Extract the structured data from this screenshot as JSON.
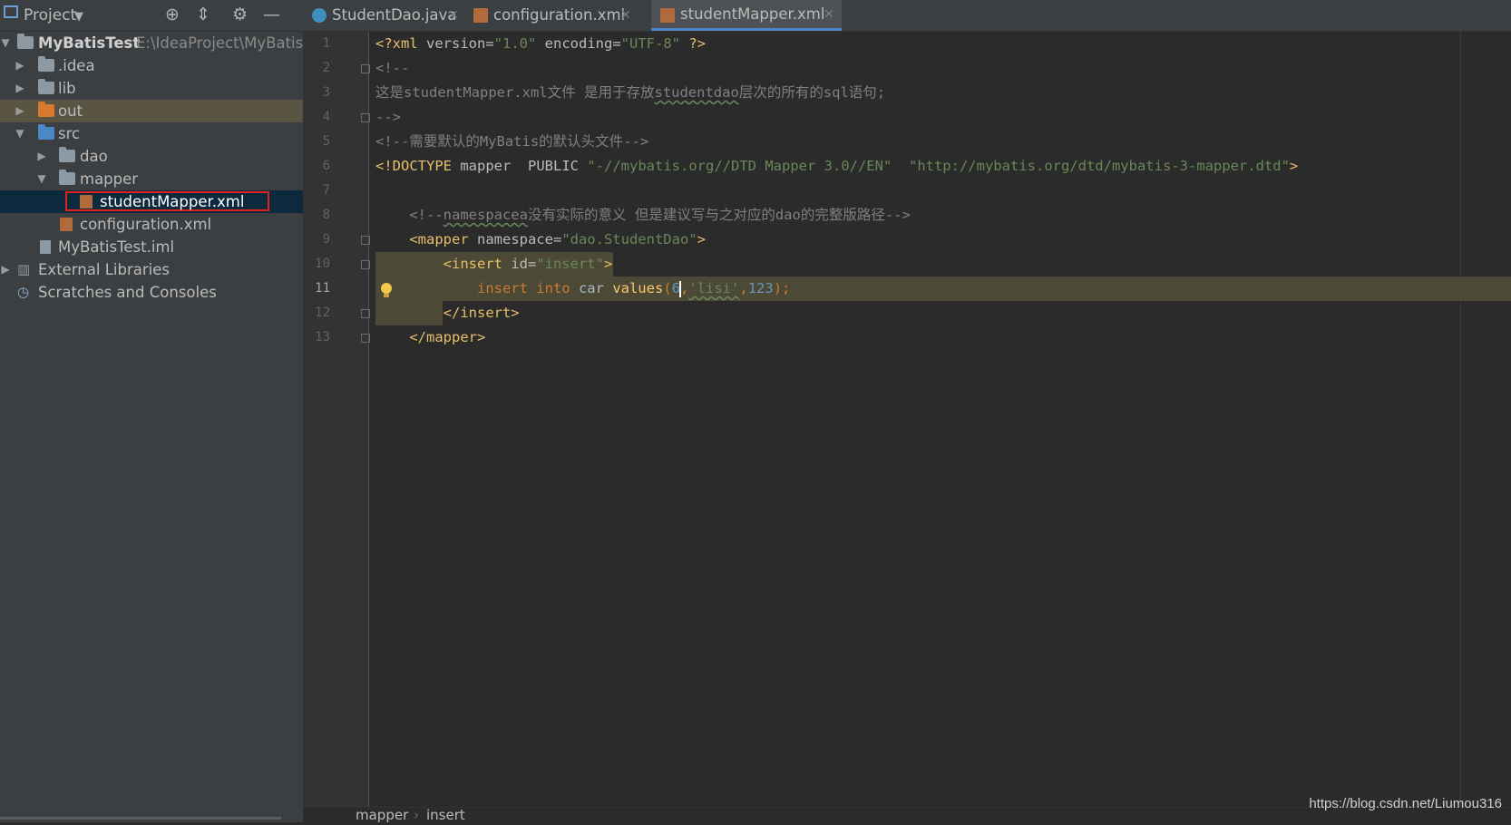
{
  "sidebar": {
    "title": "Project",
    "tree": [
      {
        "label": "MyBatisTest",
        "path": "E:\\IdeaProject\\MyBatisTe"
      },
      {
        "label": ".idea"
      },
      {
        "label": "lib"
      },
      {
        "label": "out"
      },
      {
        "label": "src"
      },
      {
        "label": "dao"
      },
      {
        "label": "mapper"
      },
      {
        "label": "studentMapper.xml"
      },
      {
        "label": "configuration.xml"
      },
      {
        "label": "MyBatisTest.iml"
      },
      {
        "label": "External Libraries"
      },
      {
        "label": "Scratches and Consoles"
      }
    ]
  },
  "tabs": [
    {
      "label": "StudentDao.java",
      "icon": "java-class-icon"
    },
    {
      "label": "configuration.xml",
      "icon": "xml-file-icon"
    },
    {
      "label": "studentMapper.xml",
      "icon": "xml-file-icon",
      "active": true
    }
  ],
  "editor": {
    "line_numbers": [
      "1",
      "2",
      "3",
      "4",
      "5",
      "6",
      "7",
      "8",
      "9",
      "10",
      "11",
      "12",
      "13"
    ],
    "current_line": "11",
    "lines": [
      "<?xml version=\"1.0\" encoding=\"UTF-8\" ?>",
      "<!--",
      "这是studentMapper.xml文件 是用于存放studentdao层次的所有的sql语句;",
      "-->",
      "<!--需要默认的MyBatis的默认头文件-->",
      "<!DOCTYPE mapper  PUBLIC \"-//mybatis.org//DTD Mapper 3.0//EN\"  \"http://mybatis.org/dtd/mybatis-3-mapper.dtd\">",
      "",
      "    <!--namespacea没有实际的意义 但是建议写与之对应的dao的完整版路径-->",
      "    <mapper namespace=\"dao.StudentDao\">",
      "        <insert id=\"insert\">",
      "            insert into car values(6,'lisi',123);",
      "        </insert>",
      "    </mapper>"
    ]
  },
  "breadcrumb": [
    "mapper",
    "insert"
  ],
  "watermark": "https://blog.csdn.net/Liumou316",
  "colors": {
    "accent": "#4a88c7",
    "selection_border": "#e0211e",
    "xml_tag": "#e8bf6a",
    "string": "#6a8759",
    "comment": "#808080"
  }
}
